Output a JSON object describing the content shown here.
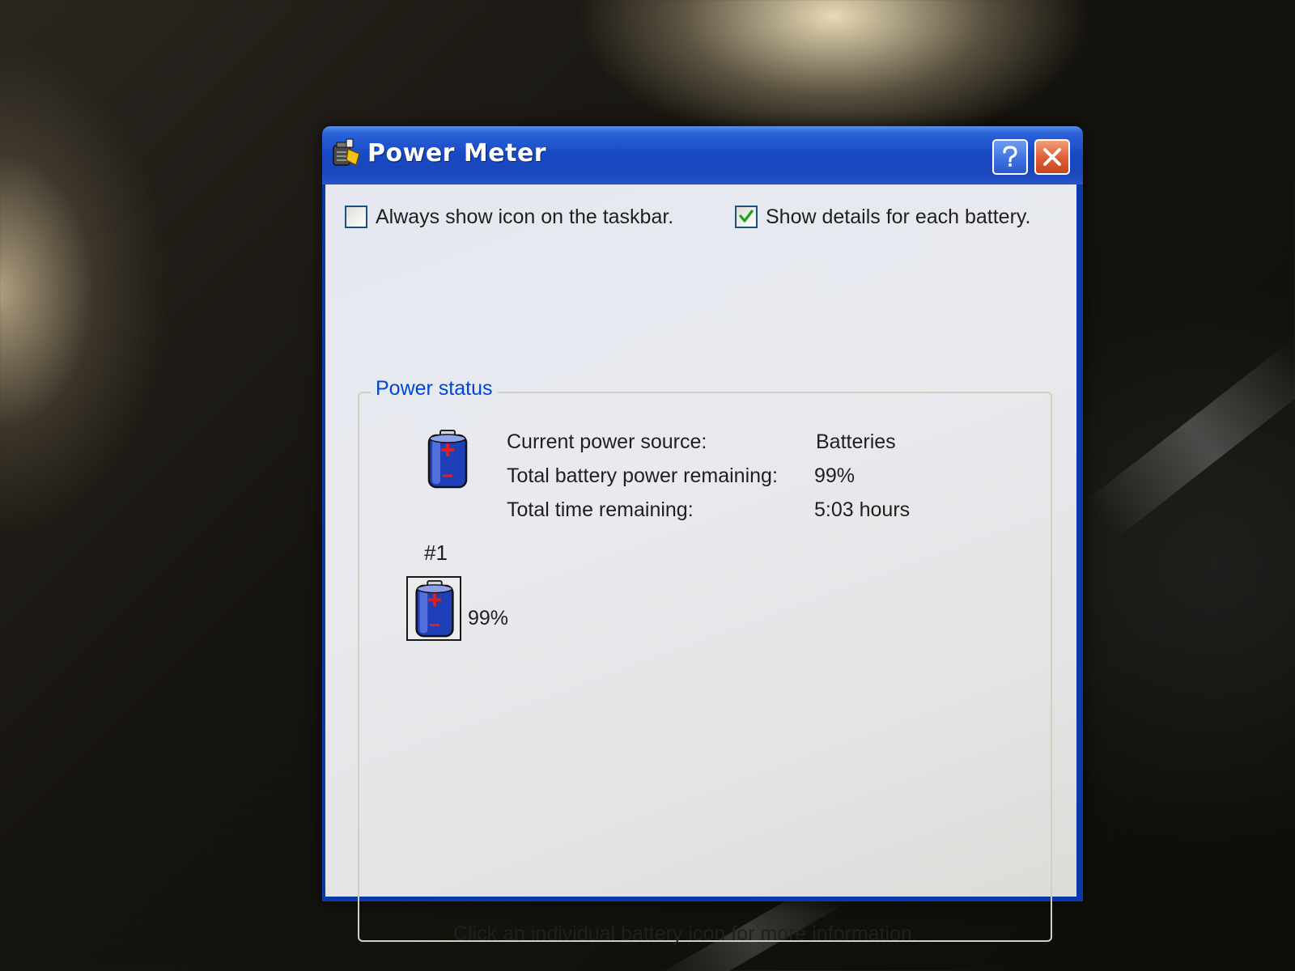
{
  "window": {
    "title": "Power Meter",
    "help_label": "?",
    "close_label": "✕"
  },
  "options": {
    "always_show_icon": {
      "label": "Always show icon on the taskbar.",
      "checked": false
    },
    "show_details": {
      "label": "Show details for each battery.",
      "checked": true
    }
  },
  "power_status": {
    "group_title": "Power status",
    "rows": [
      {
        "label": "Current power source:",
        "value": "Batteries"
      },
      {
        "label": "Total battery power remaining:",
        "value": "99%"
      },
      {
        "label": "Total time remaining:",
        "value": "5:03 hours"
      }
    ]
  },
  "batteries": [
    {
      "number": "#1",
      "percent": "99%"
    }
  ],
  "footer": "Click an individual battery icon for more information.",
  "colors": {
    "title_bar": "#1848c4",
    "group_title": "#0046d5",
    "close_button": "#e0603a",
    "battery_body": "#1f3fb8",
    "battery_plus": "#e02020"
  }
}
